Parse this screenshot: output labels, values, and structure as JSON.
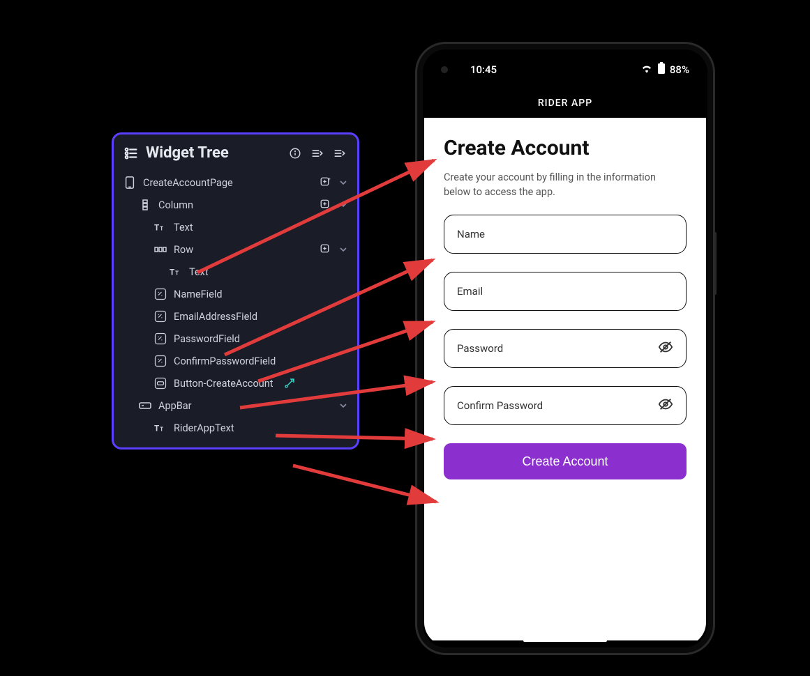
{
  "widget_tree": {
    "title": "Widget Tree",
    "items": [
      {
        "label": "CreateAccountPage"
      },
      {
        "label": "Column"
      },
      {
        "label": "Text"
      },
      {
        "label": "Row"
      },
      {
        "label": "Text"
      },
      {
        "label": "NameField"
      },
      {
        "label": "EmailAddressField"
      },
      {
        "label": "PasswordField"
      },
      {
        "label": "ConfirmPasswordField"
      },
      {
        "label": "Button-CreateAccount"
      },
      {
        "label": "AppBar"
      },
      {
        "label": "RiderAppText"
      }
    ]
  },
  "phone": {
    "status_time": "10:45",
    "battery_text": "88%",
    "appbar_title": "RIDER APP",
    "screen": {
      "title": "Create Account",
      "subtitle": "Create your account by filling in the information below to access the app.",
      "name_placeholder": "Name",
      "email_placeholder": "Email",
      "password_placeholder": "Password",
      "confirm_password_placeholder": "Confirm Password",
      "cta_label": "Create Account"
    }
  }
}
